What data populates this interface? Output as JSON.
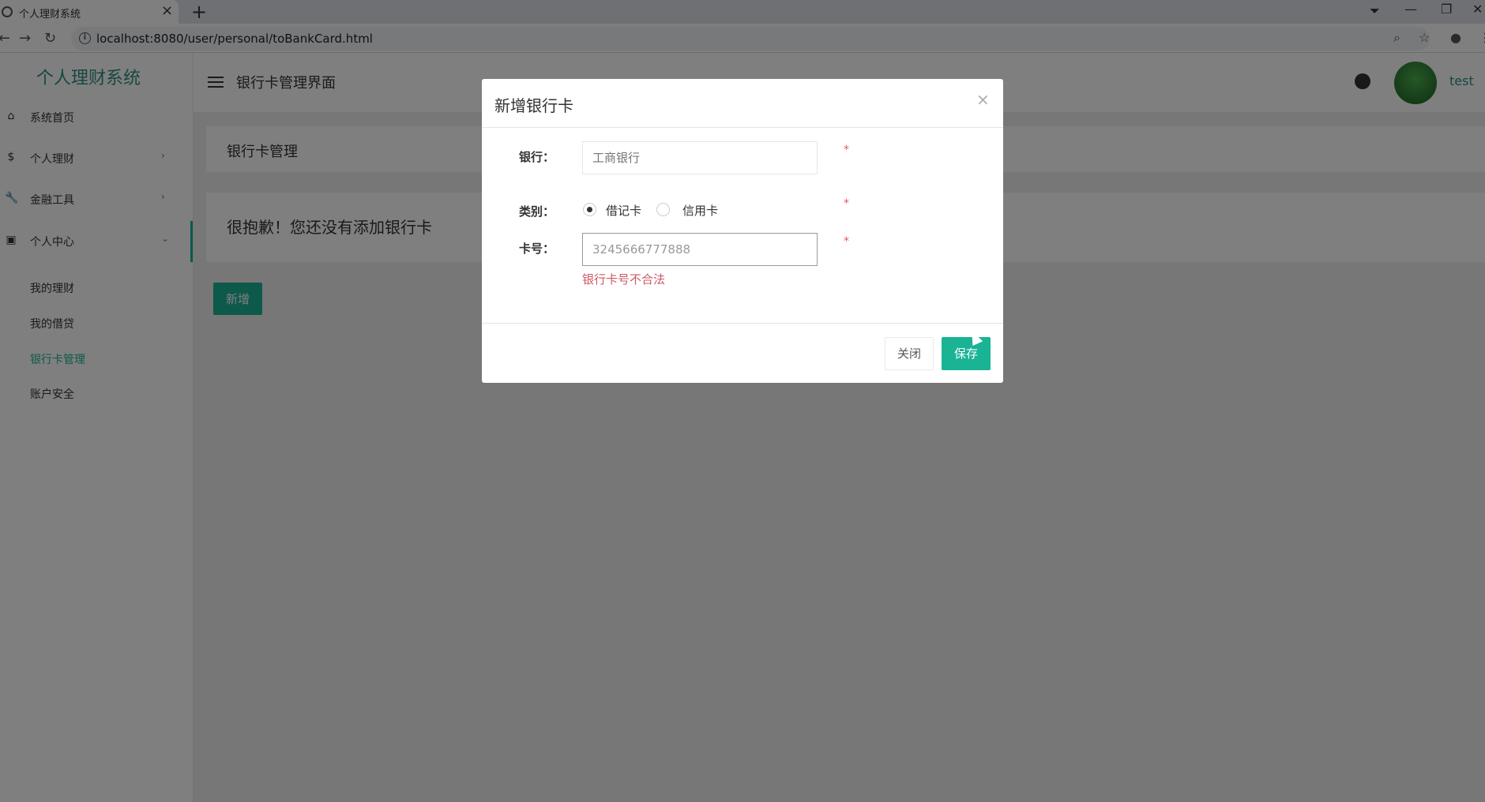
{
  "browser": {
    "tab_title": "个人理财系统",
    "url": "localhost:8080/user/personal/toBankCard.html"
  },
  "app": {
    "logo": "个人理财系统",
    "page_title": "银行卡管理界面",
    "username": "test"
  },
  "sidebar": {
    "items": [
      {
        "label": "系统首页"
      },
      {
        "label": "个人理财"
      },
      {
        "label": "金融工具"
      },
      {
        "label": "个人中心"
      }
    ],
    "sub_items": [
      {
        "label": "我的理财"
      },
      {
        "label": "我的借贷"
      },
      {
        "label": "银行卡管理"
      },
      {
        "label": "账户安全"
      }
    ]
  },
  "main": {
    "breadcrumb": "银行卡管理",
    "empty_message": "很抱歉！您还没有添加银行卡",
    "add_button": "新增"
  },
  "modal": {
    "title": "新增银行卡",
    "close_glyph": "×",
    "bank_label": "银行：",
    "bank_placeholder": "工商银行",
    "type_label": "类别：",
    "type_options": [
      "借记卡",
      "信用卡"
    ],
    "card_label": "卡号：",
    "card_value": "3245666777888",
    "card_error": "银行卡号不合法",
    "required_mark": "*",
    "btn_close": "关闭",
    "btn_save": "保存"
  },
  "colors": {
    "accent": "#1ab394",
    "error": "#cc5965"
  }
}
